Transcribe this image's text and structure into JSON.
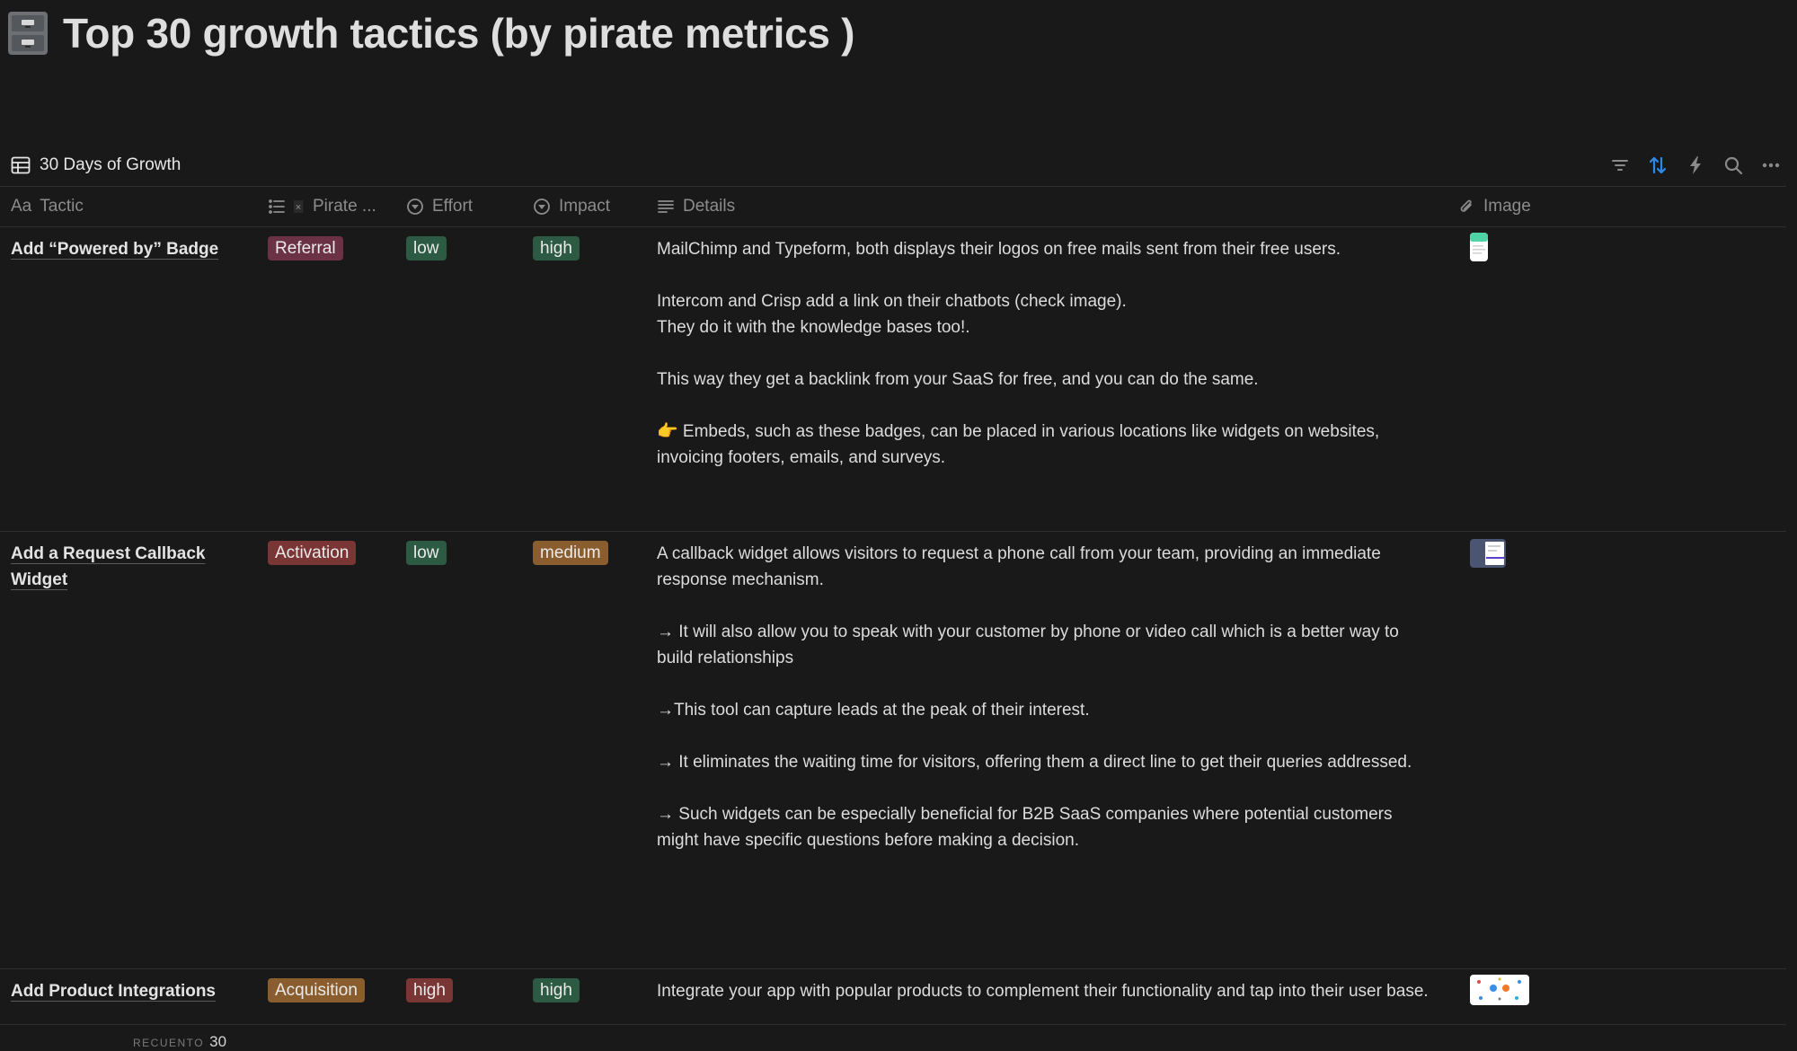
{
  "page": {
    "icon": "file-cabinet-icon",
    "title": "Top 30 growth tactics (by pirate metrics )"
  },
  "view": {
    "name": "30 Days of Growth",
    "icon": "table-icon",
    "actions": [
      {
        "name": "filter",
        "icon": "filter-icon"
      },
      {
        "name": "sort",
        "icon": "sort-icon",
        "active_color": "#2f8ae5"
      },
      {
        "name": "automations",
        "icon": "lightning-icon"
      },
      {
        "name": "search",
        "icon": "search-icon"
      },
      {
        "name": "more",
        "icon": "more-horizontal-icon"
      }
    ]
  },
  "columns": [
    {
      "key": "tactic",
      "label": "Tactic",
      "prefix": "Aa"
    },
    {
      "key": "pirate",
      "label": "Pirate ..."
    },
    {
      "key": "effort",
      "label": "Effort"
    },
    {
      "key": "impact",
      "label": "Impact"
    },
    {
      "key": "details",
      "label": "Details"
    },
    {
      "key": "image",
      "label": "Image"
    }
  ],
  "rows": [
    {
      "tactic": "Add “Powered by” Badge",
      "pirate": "Referral",
      "effort": "low",
      "impact": "high",
      "details": [
        "MailChimp and Typeform, both displays their logos on free mails sent from their free users.",
        "Intercom and Crisp add a link on their chatbots (check image).\nThey do it with the knowledge bases too!.",
        "This way they get a backlink from your SaaS for free, and you can do the same.",
        "👉 Embeds, such as these badges, can be placed in various locations like widgets on websites, invoicing footers, emails, and surveys."
      ],
      "image": "thumbnail-phone-mockup"
    },
    {
      "tactic": "Add a Request Callback Widget",
      "pirate": "Activation",
      "effort": "low",
      "impact": "medium",
      "details": [
        "A callback widget allows visitors to request a phone call from your team, providing an immediate response mechanism.",
        "→ It will also allow you to speak with your customer by phone or video call which is a better way to build relationships",
        "→This tool can capture leads at the peak of their interest.",
        "→ It eliminates the waiting time for visitors, offering them a direct line to get their queries addressed.",
        "→ Such widgets can be especially beneficial for B2B SaaS companies where potential customers might have specific questions before making a decision."
      ],
      "image": "thumbnail-callback-widget"
    },
    {
      "tactic": "Add Product Integrations",
      "pirate": "Acquisition",
      "effort": "high",
      "impact": "high",
      "details": [
        "Integrate your app with popular products to complement their functionality and tap into their user base."
      ],
      "image": "thumbnail-integrations-diagram"
    }
  ],
  "tag_colors": {
    "Referral": "#6b3145",
    "Activation": "#7a3535",
    "Acquisition": "#8a5d2e",
    "low": "#2d5a42",
    "medium": "#8a5d2e",
    "high_effort": "#7a3535",
    "high_impact": "#2d5a42"
  },
  "footer": {
    "count_label": "RECUENTO",
    "count_value": "30"
  }
}
